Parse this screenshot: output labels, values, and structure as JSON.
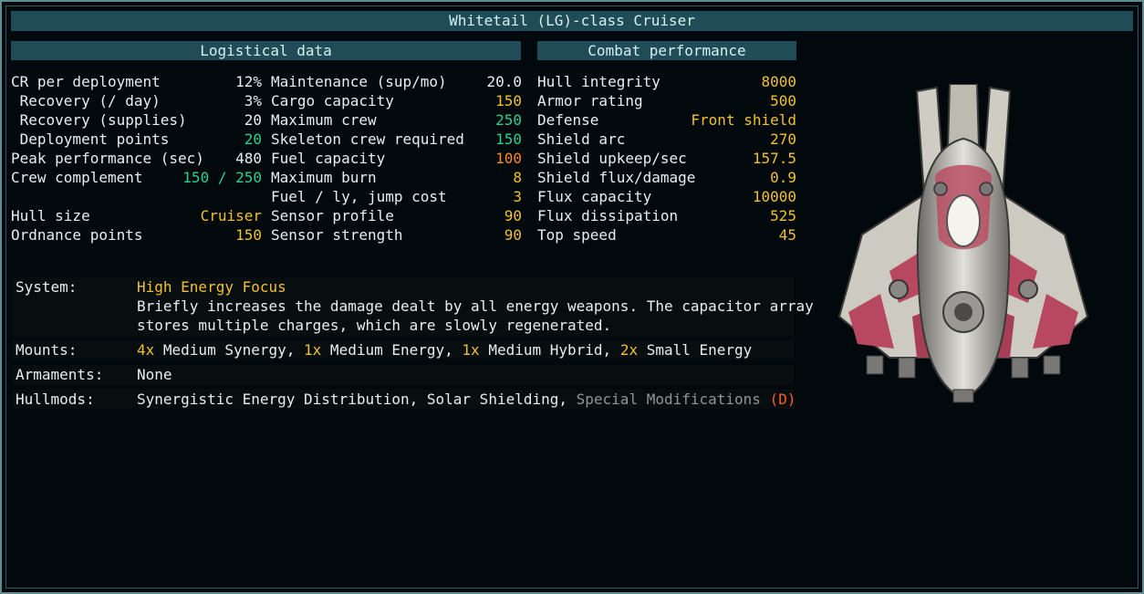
{
  "title": "Whitetail (LG)-class Cruiser",
  "logistical_header": "Logistical data",
  "combat_header": "Combat performance",
  "col1": [
    {
      "label": "CR per deployment",
      "value": "12%",
      "color": "white"
    },
    {
      "label": " Recovery (/ day)",
      "value": "3%",
      "color": "white"
    },
    {
      "label": " Recovery (supplies)",
      "value": "20",
      "color": "white"
    },
    {
      "label": " Deployment points",
      "value": "20",
      "color": "green"
    },
    {
      "label": "Peak performance (sec)",
      "value": "480",
      "color": "white"
    },
    {
      "label": "Crew complement",
      "value": "150 / 250",
      "color": "green"
    },
    {
      "label": "",
      "value": "",
      "color": "white"
    },
    {
      "label": "Hull size",
      "value": "Cruiser",
      "color": "yellow"
    },
    {
      "label": "Ordnance points",
      "value": "150",
      "color": "yellow"
    }
  ],
  "col2": [
    {
      "label": "Maintenance (sup/mo)",
      "value": "20.0",
      "color": "white"
    },
    {
      "label": "Cargo capacity",
      "value": "150",
      "color": "yellow"
    },
    {
      "label": "Maximum crew",
      "value": "250",
      "color": "green"
    },
    {
      "label": "Skeleton crew required",
      "value": "150",
      "color": "green"
    },
    {
      "label": "Fuel capacity",
      "value": "100",
      "color": "orange"
    },
    {
      "label": "Maximum burn",
      "value": "8",
      "color": "yellow"
    },
    {
      "label": "Fuel / ly, jump cost",
      "value": "3",
      "color": "yellow"
    },
    {
      "label": "Sensor profile",
      "value": "90",
      "color": "yellow"
    },
    {
      "label": "Sensor strength",
      "value": "90",
      "color": "yellow"
    }
  ],
  "col3": [
    {
      "label": "Hull integrity",
      "value": "8000",
      "color": "yellow"
    },
    {
      "label": "Armor rating",
      "value": "500",
      "color": "yellow"
    },
    {
      "label": "Defense",
      "value": "Front shield",
      "color": "yellow"
    },
    {
      "label": "Shield arc",
      "value": "270",
      "color": "yellow"
    },
    {
      "label": "Shield upkeep/sec",
      "value": "157.5",
      "color": "yellow"
    },
    {
      "label": "Shield flux/damage",
      "value": "0.9",
      "color": "yellow"
    },
    {
      "label": "Flux capacity",
      "value": "10000",
      "color": "yellow"
    },
    {
      "label": "Flux dissipation",
      "value": "525",
      "color": "yellow"
    },
    {
      "label": "Top speed",
      "value": "45",
      "color": "yellow"
    }
  ],
  "system": {
    "key": "System:",
    "name": "High Energy Focus",
    "desc1": "Briefly increases the damage dealt by all energy weapons. The capacitor array",
    "desc2": "stores multiple charges, which are slowly regenerated."
  },
  "mounts": {
    "key": "Mounts:",
    "items": [
      {
        "count": "4x",
        "text": " Medium Synergy, "
      },
      {
        "count": "1x",
        "text": " Medium Energy, "
      },
      {
        "count": "1x",
        "text": " Medium Hybrid, "
      },
      {
        "count": "2x",
        "text": " Small Energy"
      }
    ]
  },
  "armaments": {
    "key": "Armaments:",
    "value": "None"
  },
  "hullmods": {
    "key": "Hullmods:",
    "mods": "Synergistic Energy Distribution, Solar Shielding, ",
    "special": "Special Modifications",
    "tag": " (D)"
  },
  "colors": {
    "panel_header": "#1f4c56",
    "yellow": "#f2c12b",
    "green": "#29d193",
    "orange": "#ff8a1e",
    "hull_pink": "#b8485f"
  }
}
